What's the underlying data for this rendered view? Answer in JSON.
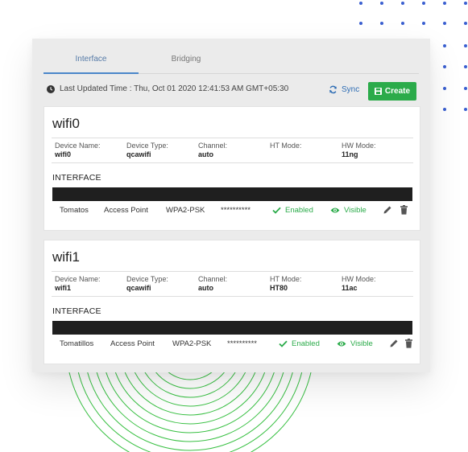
{
  "tabs": [
    {
      "label": "Interface",
      "active": true
    },
    {
      "label": "Bridging",
      "active": false
    }
  ],
  "toolbar": {
    "last_updated": "Last Updated Time : Thu, Oct 01 2020 12:41:53 AM GMT+05:30",
    "sync_label": "Sync",
    "create_label": "Create"
  },
  "colors": {
    "accent": "#2e6db4",
    "create_button": "#2bab4a",
    "status_green": "#2bab4a",
    "table_header": "#1f1f1f",
    "dots": "#3a5fd0",
    "rings": "#39c043"
  },
  "icons": {
    "clock": "clock-icon",
    "sync": "sync-icon",
    "create": "save-icon",
    "enabled": "check-icon",
    "visible": "eye-icon",
    "edit": "pencil-icon",
    "delete": "trash-icon"
  },
  "radios": [
    {
      "name": "wifi0",
      "props": [
        {
          "label": "Device Name:",
          "value": "wifi0"
        },
        {
          "label": "Device Type:",
          "value": "qcawifi"
        },
        {
          "label": "Channel:",
          "value": "auto"
        },
        {
          "label": "HT Mode:",
          "value": ""
        },
        {
          "label": "HW Mode:",
          "value": "11ng"
        }
      ],
      "section_title": "INTERFACE",
      "interfaces": [
        {
          "ssid": "Tomatos",
          "mode": "Access Point",
          "security": "WPA2-PSK",
          "key": "**********",
          "status": "Enabled",
          "visibility": "Visible"
        }
      ]
    },
    {
      "name": "wifi1",
      "props": [
        {
          "label": "Device Name:",
          "value": "wifi1"
        },
        {
          "label": "Device Type:",
          "value": "qcawifi"
        },
        {
          "label": "Channel:",
          "value": "auto"
        },
        {
          "label": "HT Mode:",
          "value": "HT80"
        },
        {
          "label": "HW Mode:",
          "value": "11ac"
        }
      ],
      "section_title": "INTERFACE",
      "interfaces": [
        {
          "ssid": "Tomatillos",
          "mode": "Access Point",
          "security": "WPA2-PSK",
          "key": "**********",
          "status": "Enabled",
          "visibility": "Visible"
        }
      ]
    }
  ]
}
